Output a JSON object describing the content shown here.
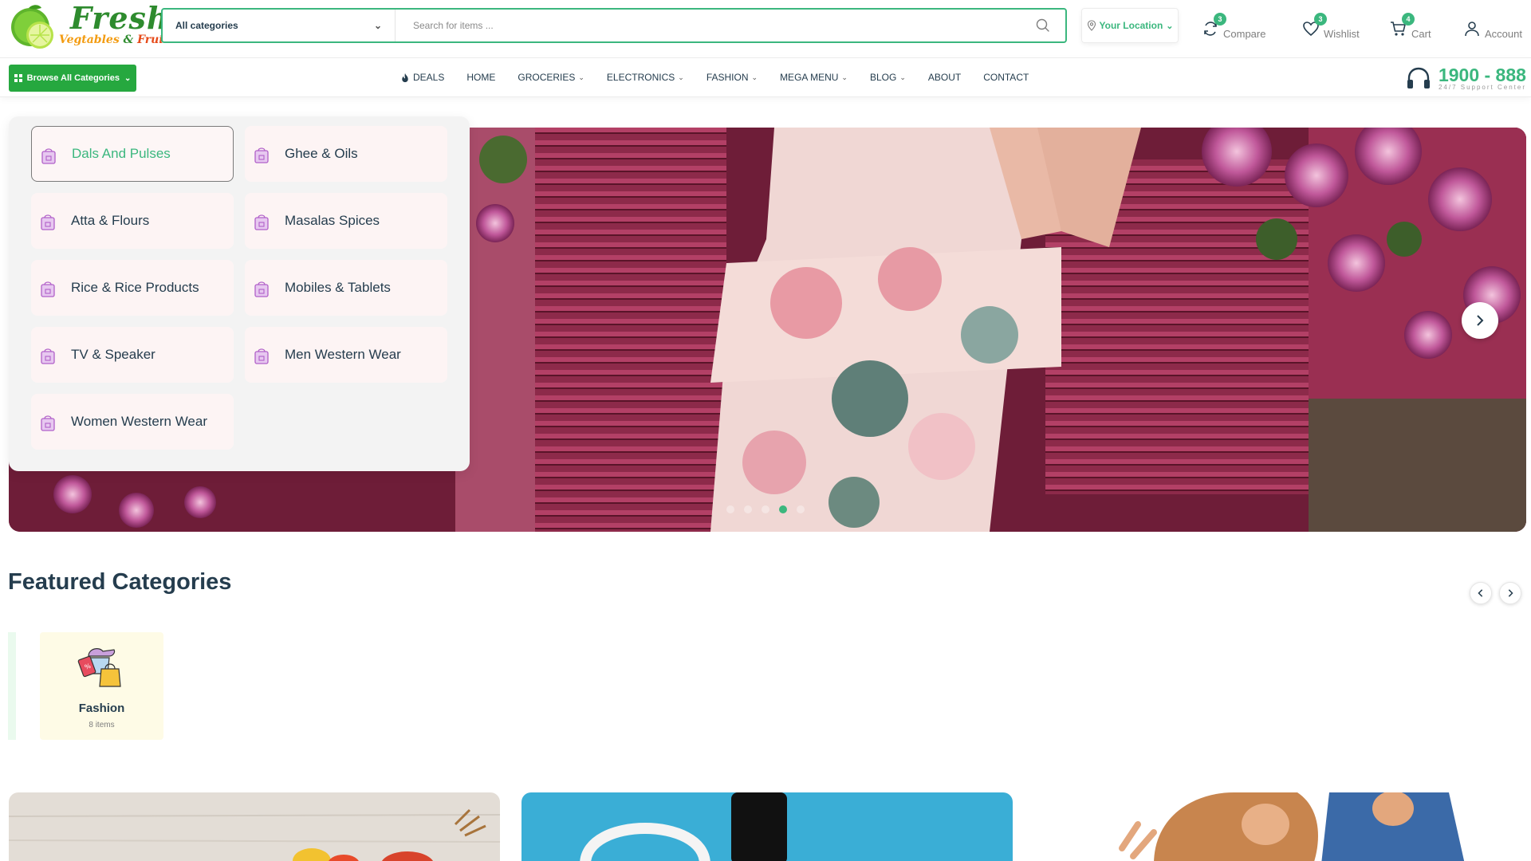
{
  "logo": {
    "word1": "Fresh",
    "word2_a": "Vegtables",
    "word2_amp": " & ",
    "word2_b": "Fruits"
  },
  "search": {
    "category": "All categories",
    "placeholder": "Search for items ..."
  },
  "location": {
    "label": "Your Location"
  },
  "header_actions": [
    {
      "label": "Compare",
      "count": "3",
      "icon": "compare-icon"
    },
    {
      "label": "Wishlist",
      "count": "3",
      "icon": "heart-icon"
    },
    {
      "label": "Cart",
      "count": "4",
      "icon": "cart-icon"
    },
    {
      "label": "Account",
      "icon": "user-icon"
    }
  ],
  "nav": {
    "browse_label": "Browse All Categories",
    "items": [
      {
        "label": "DEALS",
        "icon": "fire-icon"
      },
      {
        "label": "HOME"
      },
      {
        "label": "GROCERIES",
        "dropdown": true
      },
      {
        "label": "ELECTRONICS",
        "dropdown": true
      },
      {
        "label": "FASHION",
        "dropdown": true
      },
      {
        "label": "MEGA MENU",
        "dropdown": true
      },
      {
        "label": "BLOG",
        "dropdown": true
      },
      {
        "label": "ABOUT"
      },
      {
        "label": "CONTACT"
      }
    ],
    "support_number": "1900 - 888",
    "support_sub": "24/7 Support Center"
  },
  "category_menu": [
    {
      "label": "Dals And Pulses",
      "active": true
    },
    {
      "label": "Ghee & Oils"
    },
    {
      "label": "Atta & Flours"
    },
    {
      "label": "Masalas Spices"
    },
    {
      "label": "Rice & Rice Products"
    },
    {
      "label": "Mobiles & Tablets"
    },
    {
      "label": "TV & Speaker"
    },
    {
      "label": "Men Western Wear"
    },
    {
      "label": "Women Western Wear"
    }
  ],
  "hero": {
    "slide_count": 5,
    "active_slide": 4
  },
  "featured": {
    "title": "Featured Categories",
    "cards": [
      {
        "name": "Fashion",
        "count": "8 items",
        "icon": "fashion-icon"
      }
    ]
  },
  "colors": {
    "accent": "#3bb77e",
    "browse_button": "#26a83f",
    "heading": "#253d4e"
  }
}
